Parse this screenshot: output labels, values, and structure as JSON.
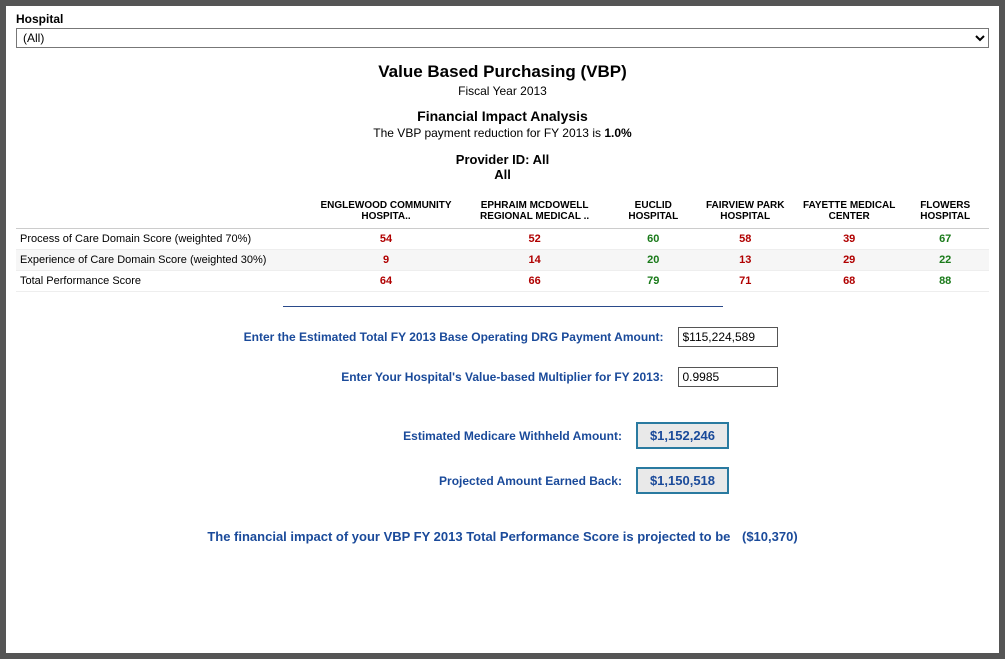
{
  "filter": {
    "label": "Hospital",
    "value": "(All)"
  },
  "header": {
    "title": "Value Based Purchasing (VBP)",
    "fiscal_year": "Fiscal Year 2013",
    "section_title": "Financial Impact Analysis",
    "reduction_prefix": "The VBP payment reduction for FY 2013 is ",
    "reduction_value": "1.0%",
    "provider_label": "Provider ID: All",
    "provider_value": "All"
  },
  "columns": [
    "ENGLEWOOD COMMUNITY HOSPITA..",
    "EPHRAIM MCDOWELL REGIONAL MEDICAL ..",
    "EUCLID HOSPITAL",
    "FAIRVIEW PARK HOSPITAL",
    "FAYETTE MEDICAL CENTER",
    "FLOWERS HOSPITAL"
  ],
  "rows": [
    {
      "label": "Process of Care Domain Score  (weighted 70%)",
      "values": [
        {
          "v": "54",
          "cls": "red"
        },
        {
          "v": "52",
          "cls": "red"
        },
        {
          "v": "60",
          "cls": "green"
        },
        {
          "v": "58",
          "cls": "red"
        },
        {
          "v": "39",
          "cls": "red"
        },
        {
          "v": "67",
          "cls": "green"
        }
      ]
    },
    {
      "label": "Experience of Care Domain Score  (weighted 30%)",
      "alt": true,
      "values": [
        {
          "v": "9",
          "cls": "red"
        },
        {
          "v": "14",
          "cls": "red"
        },
        {
          "v": "20",
          "cls": "green"
        },
        {
          "v": "13",
          "cls": "red"
        },
        {
          "v": "29",
          "cls": "red"
        },
        {
          "v": "22",
          "cls": "green"
        }
      ]
    },
    {
      "label": "Total Performance Score",
      "values": [
        {
          "v": "64",
          "cls": "red"
        },
        {
          "v": "66",
          "cls": "red"
        },
        {
          "v": "79",
          "cls": "green"
        },
        {
          "v": "71",
          "cls": "red"
        },
        {
          "v": "68",
          "cls": "red"
        },
        {
          "v": "88",
          "cls": "green"
        }
      ]
    }
  ],
  "inputs": {
    "drg_label": "Enter the Estimated Total FY 2013  Base Operating  DRG Payment Amount:",
    "drg_value": "$115,224,589",
    "mult_label": "Enter Your Hospital's Value-based Multiplier for FY 2013:",
    "mult_value": "0.9985"
  },
  "results": {
    "withheld_label": "Estimated Medicare Withheld Amount:",
    "withheld_value": "$1,152,246",
    "earned_label": "Projected Amount Earned Back:",
    "earned_value": "$1,150,518"
  },
  "impact": {
    "text": "The financial impact of your VBP FY 2013 Total Performance Score is projected to be",
    "amount": "($10,370)"
  }
}
